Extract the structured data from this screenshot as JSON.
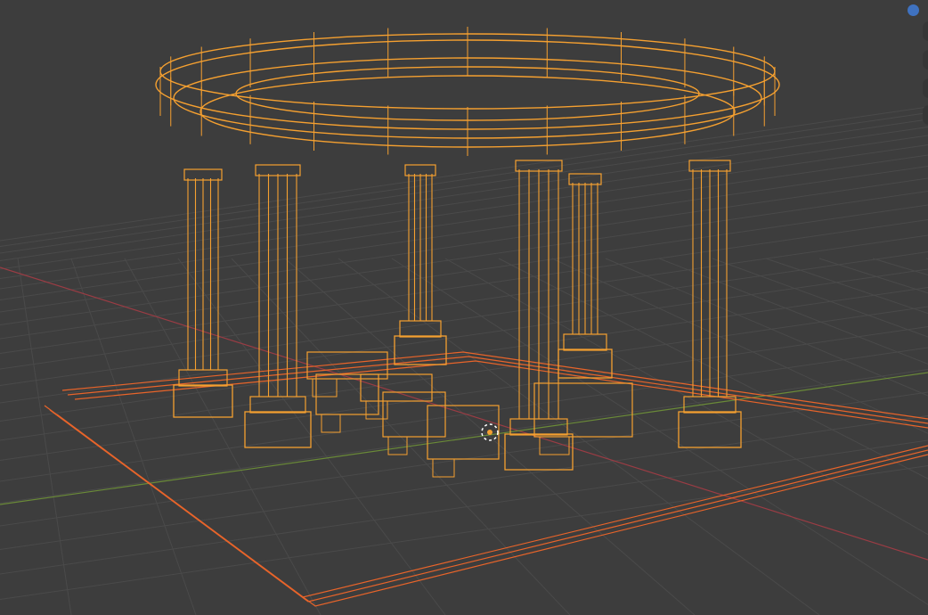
{
  "viewport": {
    "mode": "wireframe",
    "background_color": "#3d3d3d",
    "grid_color": "#4a4a4a",
    "x_axis_color": "#9a3c44",
    "y_axis_color": "#6a8a38",
    "selected_color": "#f5a030",
    "active_color": "#e8642a",
    "gizmo_dot_color": "#3f72c0"
  },
  "scene": {
    "columns": 6,
    "benches": 6
  }
}
